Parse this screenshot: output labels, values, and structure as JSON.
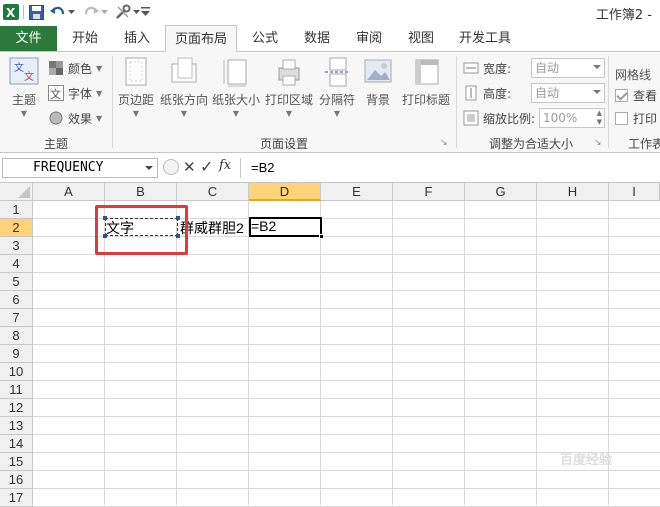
{
  "window": {
    "title": "工作簿2 -"
  },
  "quick_access": {
    "icons": [
      "excel-logo-icon",
      "save-icon",
      "undo-icon",
      "redo-icon",
      "tools-icon",
      "customize-icon"
    ]
  },
  "tabs": [
    {
      "label": "文件",
      "state": "file"
    },
    {
      "label": "开始",
      "state": "normal"
    },
    {
      "label": "插入",
      "state": "normal"
    },
    {
      "label": "页面布局",
      "state": "active"
    },
    {
      "label": "公式",
      "state": "normal"
    },
    {
      "label": "数据",
      "state": "normal"
    },
    {
      "label": "审阅",
      "state": "normal"
    },
    {
      "label": "视图",
      "state": "normal"
    },
    {
      "label": "开发工具",
      "state": "normal"
    }
  ],
  "ribbon": {
    "theme_group": {
      "label": "主题",
      "big_button": "主题",
      "small": [
        "颜色",
        "字体",
        "效果"
      ]
    },
    "page_setup_group": {
      "label": "页面设置",
      "buttons": [
        "页边距",
        "纸张方向",
        "纸张大小",
        "打印区域",
        "分隔符",
        "背景",
        "打印标题"
      ]
    },
    "scale_group": {
      "label": "调整为合适大小",
      "width_label": "宽度:",
      "width_value": "自动",
      "height_label": "高度:",
      "height_value": "自动",
      "scale_label": "缩放比例:",
      "scale_value": "100%"
    },
    "sheet_options_group": {
      "label": "工作表",
      "title": "网格线",
      "view_label": "查看",
      "print_label": "打印"
    }
  },
  "formula_bar": {
    "name_box": "FREQUENCY",
    "formula": "=B2"
  },
  "sheet": {
    "columns": [
      "A",
      "B",
      "C",
      "D",
      "E",
      "F",
      "G",
      "H",
      "I"
    ],
    "rows": [
      "1",
      "2",
      "3",
      "4",
      "5",
      "6",
      "7",
      "8",
      "9",
      "10",
      "11",
      "12",
      "13",
      "14",
      "15",
      "16",
      "17"
    ],
    "active_column": "D",
    "active_row": "2",
    "cells": {
      "B2": "文字",
      "C2": "群威群胆2",
      "D2": "=B2"
    }
  },
  "colors": {
    "file_tab": "#2a7a3b",
    "active_header": "#ffd479",
    "highlight_box": "#e03a3a"
  },
  "watermark": "百度经验"
}
